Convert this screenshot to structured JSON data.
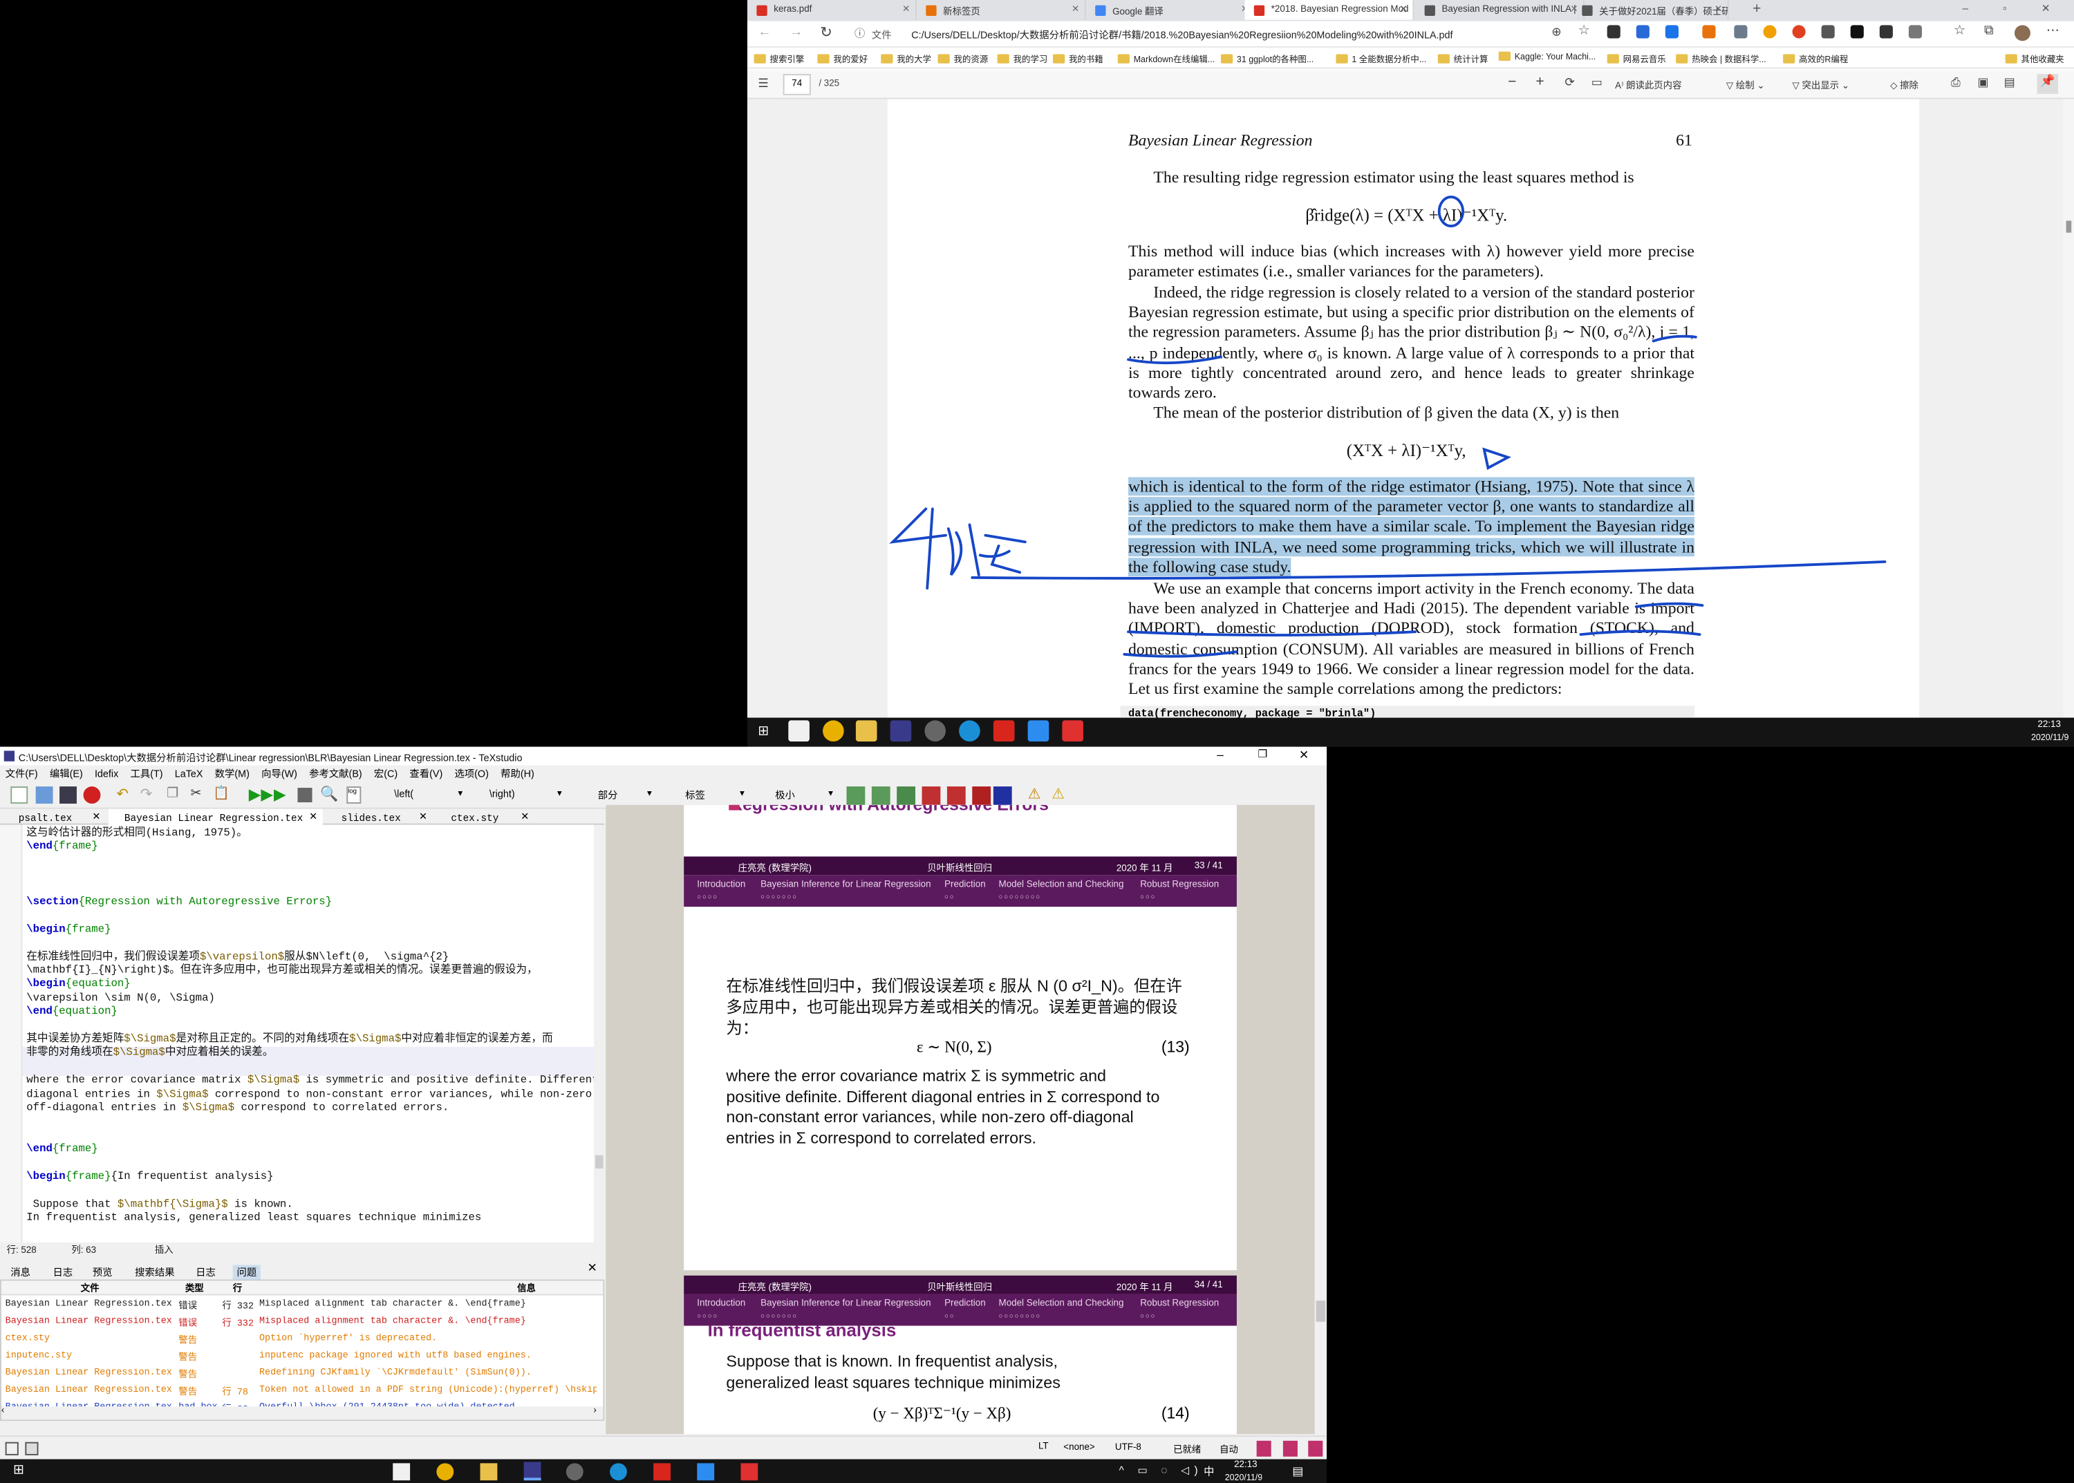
{
  "browser": {
    "tabs": [
      {
        "label": "keras.pdf",
        "color": "#d93025"
      },
      {
        "label": "新标签页",
        "color": "#e8710a"
      },
      {
        "label": "Google 翻译",
        "color": "#4285f4"
      },
      {
        "label": "*2018. Bayesian Regression Mod",
        "color": "#d93025"
      },
      {
        "label": "Bayesian Regression with INLA |",
        "color": "#555555"
      },
      {
        "label": "关于做好2021届（春季）硕士研",
        "color": "#555555"
      }
    ],
    "address_prefix": "文件",
    "address": "C:/Users/DELL/Desktop/大数据分析前沿讨论群/书籍/2018.%20Bayesian%20Regresiion%20Modeling%20with%20INLA.pdf",
    "bookmarks": [
      "搜索引擎",
      "我的爱好",
      "我的大学",
      "我的资源",
      "我的学习",
      "我的书籍",
      "Markdown在线编辑...",
      "31 ggplot的各种图...",
      "1 全能数据分析中...",
      "统计计算",
      "Kaggle: Your Machi...",
      "网易云音乐",
      "热映会 | 数据科学...",
      "高效的R编程"
    ],
    "other_bookmarks": "其他收藏夹",
    "pdf_page": "74",
    "pdf_total": "/ 325",
    "pdf_tools": [
      "朗读此页内容",
      "绘制",
      "突出显示",
      "擦除"
    ]
  },
  "pdf": {
    "running_head": "Bayesian Linear Regression",
    "page_number": "61",
    "p1": "The resulting ridge regression estimator using the least squares method is",
    "eq1": "β̂ridge(λ) = (XᵀX + λI)⁻¹Xᵀy.",
    "p2": "This method will induce bias (which increases with λ) however yield more precise parameter estimates (i.e., smaller variances for the parameters).",
    "p3": "Indeed, the ridge regression is closely related to a version of the standard posterior Bayesian regression estimate, but using a specific prior distribution on the elements of the regression parameters. Assume βⱼ has the prior distribution βⱼ ∼ N(0, σ₀²/λ), j = 1, ..., p independently, where σ₀ is known. A large value of λ corresponds to a prior that is more tightly concentrated around zero, and hence leads to greater shrinkage towards zero.",
    "p4": "The mean of the posterior distribution of β given the data (X, y) is then",
    "eq2": "(XᵀX + λI)⁻¹Xᵀy,",
    "p5_highlight": "which is identical to the form of the ridge estimator (Hsiang, 1975). Note that since λ is applied to the squared norm of the parameter vector β, one wants to standardize all of the predictors to make them have a similar scale. To implement the Bayesian ridge regression with INLA, we need some programming tricks, which we will illustrate in the following case study.",
    "p6": "We use an example that concerns import activity in the French economy. The data have been analyzed in Chatterjee and Hadi (2015). The dependent variable is import (IMPORT), domestic production (DOPROD), stock formation (STOCK), and domestic consumption (CONSUM). All variables are measured in billions of French francs for the years 1949 to 1966. We consider a linear regression model for the data. Let us first examine the sample correlations among the predictors:",
    "code": "data(frencheconomy, package = \"brinla\")"
  },
  "taskbar_top": {
    "time": "22:13",
    "date": "2020/11/9"
  },
  "texstudio": {
    "title": "C:\\Users\\DELL\\Desktop\\大数据分析前沿讨论群\\Linear regression\\BLR\\Bayesian Linear Regression.tex - TeXstudio",
    "menu": [
      "文件(F)",
      "编辑(E)",
      "Idefix",
      "工具(T)",
      "LaTeX",
      "数学(M)",
      "向导(W)",
      "参考文献(B)",
      "宏(C)",
      "查看(V)",
      "选项(O)",
      "帮助(H)"
    ],
    "combo_left": "\\left(",
    "combo_right": "\\right)",
    "combo_part": "部分",
    "combo_label": "标签",
    "combo_size": "极小",
    "file_tabs": [
      "psalt.tex",
      "Bayesian Linear Regression.tex",
      "slides.tex",
      "ctex.sty"
    ],
    "status": {
      "line": "行: 528",
      "col": "列: 63",
      "mode": "插入"
    },
    "log_tabs": [
      "消息",
      "日志",
      "预览",
      "搜索结果",
      "日志",
      "问题"
    ],
    "log_headers": [
      "文件",
      "类型",
      "行",
      "信息"
    ],
    "log_rows": [
      {
        "file": "Bayesian Linear Regression.tex",
        "type": "错误",
        "line": "行 332",
        "msg": "Misplaced alignment tab character &. \\end{frame}",
        "color": "#222222"
      },
      {
        "file": "Bayesian Linear Regression.tex",
        "type": "错误",
        "line": "行 332",
        "msg": "Misplaced alignment tab character &. \\end{frame}",
        "color": "#d02020"
      },
      {
        "file": "ctex.sty",
        "type": "警告",
        "line": "",
        "msg": "Option `hyperref' is deprecated.",
        "color": "#e07b00"
      },
      {
        "file": "inputenc.sty",
        "type": "警告",
        "line": "",
        "msg": "inputenc package ignored with utf8 based engines.",
        "color": "#e07b00"
      },
      {
        "file": "Bayesian Linear Regression.tex",
        "type": "警告",
        "line": "",
        "msg": "Redefining CJKfamily `\\CJKrmdefault' (SimSun(0)).",
        "color": "#e07b00"
      },
      {
        "file": "Bayesian Linear Regression.tex",
        "type": "警告",
        "line": "行 78",
        "msg": "Token not allowed in a PDF string (Unicode):(hyperref) \\hskip",
        "color": "#e07b00"
      },
      {
        "file": "Bayesian Linear Regression.tex",
        "type": "bad box",
        "line": "行 83",
        "msg": "Overfull \\hbox (291.24438pt too wide) detected",
        "color": "#2040c0"
      }
    ],
    "statusbar": [
      "LT",
      "<none>",
      "UTF-8",
      "已就绪",
      "自动"
    ]
  },
  "editor_lines": [
    {
      "t": "这与岭估计器的形式相同(Hsiang, 1975)。"
    },
    {
      "t": "\\end{frame}"
    },
    {
      "t": ""
    },
    {
      "t": ""
    },
    {
      "t": ""
    },
    {
      "t": "\\section{Regression with Autoregressive Errors}"
    },
    {
      "t": ""
    },
    {
      "t": "\\begin{frame}"
    },
    {
      "t": ""
    },
    {
      "t": "在标准线性回归中，我们假设误差项$\\varepsilon$服从$N\\left(0,  \\sigma^{2}"
    },
    {
      "t": "\\mathbf{I}_{N}\\right)$。但在许多应用中，也可能出现异方差或相关的情况。误差更普遍的假设为，"
    },
    {
      "t": "\\begin{equation}"
    },
    {
      "t": "\\varepsilon \\sim N(0, \\Sigma)"
    },
    {
      "t": "\\end{equation}"
    },
    {
      "t": ""
    },
    {
      "t": "其中误差协方差矩阵$\\Sigma$是对称且正定的。不同的对角线项在$\\Sigma$中对应着非恒定的误差方差，而"
    },
    {
      "t": "非零的对角线项在$\\Sigma$中对应着相关的误差。"
    },
    {
      "t": ""
    },
    {
      "t": "where the error covariance matrix $\\Sigma$ is symmetric and positive definite. Different"
    },
    {
      "t": "diagonal entries in $\\Sigma$ correspond to non-constant error variances, while non-zero"
    },
    {
      "t": "off-diagonal entries in $\\Sigma$ correspond to correlated errors."
    },
    {
      "t": ""
    },
    {
      "t": ""
    },
    {
      "t": "\\end{frame}"
    },
    {
      "t": ""
    },
    {
      "t": "\\begin{frame}{In frequentist analysis}"
    },
    {
      "t": ""
    },
    {
      "t": " Suppose that $\\mathbf{\\Sigma}$ is known."
    },
    {
      "t": "In frequentist analysis, generalized least squares technique minimizes"
    }
  ],
  "slides": {
    "author": "庄亮亮 (数理学院)",
    "title": "贝叶斯线性回归",
    "date": "2020 年 11 月",
    "page33": "33 / 41",
    "page34": "34 / 41",
    "nav": [
      "Introduction",
      "Bayesian Inference for Linear Regression",
      "Prediction",
      "Model Selection and Checking",
      "Robust Regression"
    ],
    "prev_heading": "Regression with Autoregressive Errors",
    "s33_zh": "在标准线性回归中，我们假设误差项 ε 服从 N (0 σ²I_N)。但在许多应用中，也可能出现异方差或相关的情况。误差更普遍的假设为：",
    "s33_eq": "ε ∼ N(0, Σ)",
    "s33_eqno": "(13)",
    "s33_en": "where the error covariance matrix Σ is symmetric and positive definite. Different diagonal entries in Σ correspond to non-constant error variances, while non-zero off-diagonal entries in Σ correspond to correlated errors.",
    "s34_title": "In frequentist analysis",
    "s34_text": "Suppose that   is known. In frequentist analysis, generalized least squares technique minimizes",
    "s34_eq": "(y − Xβ)ᵀΣ⁻¹(y − Xβ)",
    "s34_eqno": "(14)"
  },
  "taskbar_bottom": {
    "time": "22:13",
    "date": "2020/11/9",
    "ime": "中"
  }
}
